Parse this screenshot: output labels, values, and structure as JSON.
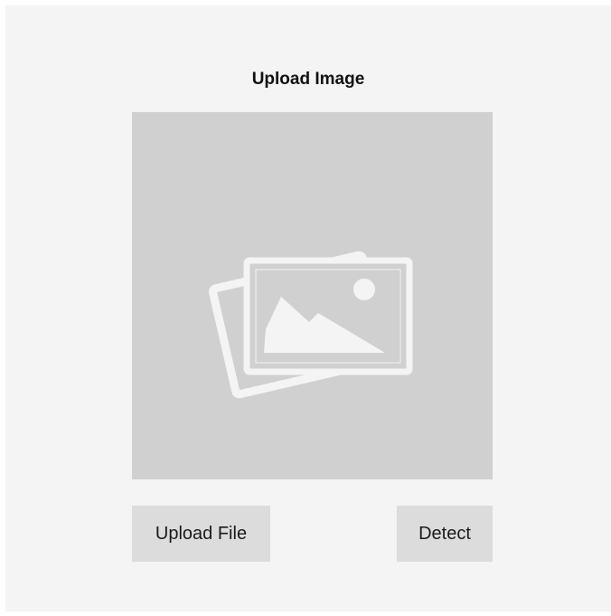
{
  "page": {
    "title": "Upload Image"
  },
  "preview": {
    "icon": "image-placeholder-icon",
    "background_color": "#d0d0d0",
    "icon_color": "#f4f4f4"
  },
  "actions": {
    "upload_label": "Upload File",
    "detect_label": "Detect"
  }
}
